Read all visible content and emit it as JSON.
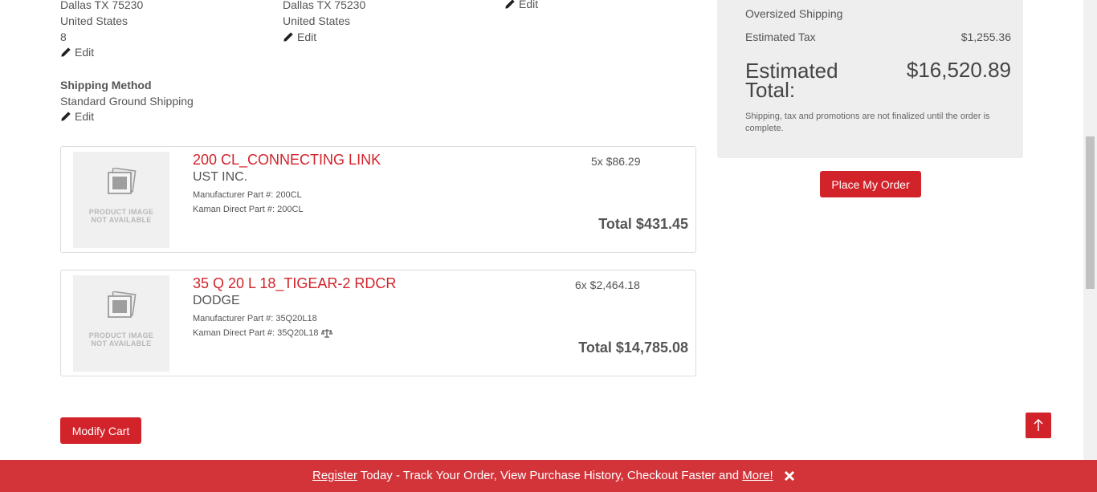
{
  "billing": {
    "city_line": "Dallas  TX  75230",
    "country": "United States",
    "extra": "8",
    "edit_label": "Edit"
  },
  "shipping": {
    "city_line": "Dallas  TX  75230",
    "country": "United States",
    "edit_label": "Edit"
  },
  "payment": {
    "edit_label": "Edit"
  },
  "shipping_method": {
    "heading": "Shipping Method",
    "value": "Standard Ground Shipping",
    "edit_label": "Edit"
  },
  "summary": {
    "oversized_label": "Oversized Shipping",
    "tax_label": "Estimated Tax",
    "tax_value": "$1,255.36",
    "total_label_line1": "Estimated",
    "total_label_line2": "Total:",
    "total_value": "$16,520.89",
    "note": "Shipping, tax and promotions are not finalized until the order is complete."
  },
  "place_order_label": "Place My Order",
  "products": [
    {
      "name": "200 CL_CONNECTING LINK",
      "brand": "UST INC.",
      "mfr_part": "Manufacturer Part #: 200CL",
      "kd_part": "Kaman Direct Part #: 200CL",
      "qty_price": "5x $86.29",
      "total": "Total $431.45",
      "image_text_1": "PRODUCT IMAGE",
      "image_text_2": "NOT AVAILABLE"
    },
    {
      "name": "35 Q 20 L 18_TIGEAR-2 RDCR",
      "brand": "DODGE",
      "mfr_part": "Manufacturer Part #: 35Q20L18",
      "kd_part": "Kaman Direct Part #: 35Q20L18",
      "qty_price": "6x $2,464.18",
      "total": "Total $14,785.08",
      "image_text_1": "PRODUCT IMAGE",
      "image_text_2": "NOT AVAILABLE"
    }
  ],
  "modify_cart_label": "Modify Cart",
  "banner": {
    "register_link": "Register",
    "middle_text": " Today - Track Your Order, View Purchase History, Checkout Faster and ",
    "more_link": "More!"
  },
  "icons": {
    "edit": "pencil-icon",
    "close": "close-icon",
    "scroll_top": "arrow-up-icon",
    "compare": "scale-icon"
  },
  "colors": {
    "accent": "#d2232a",
    "banner": "#d2343a",
    "panel": "#eeeeee"
  }
}
